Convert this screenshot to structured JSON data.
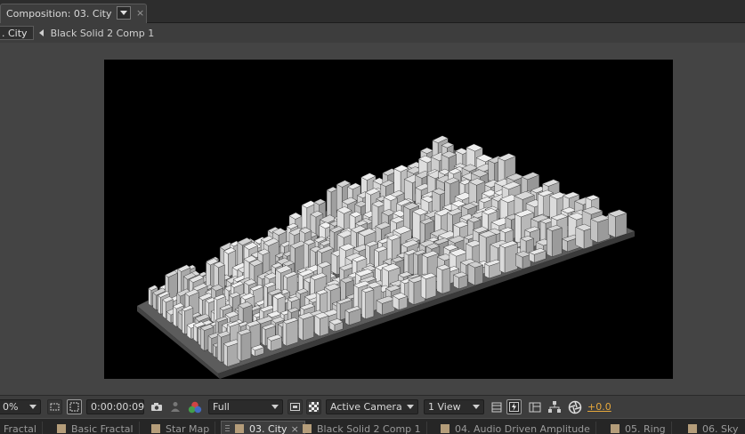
{
  "panel": {
    "tab_title": "Composition: 03. City",
    "menu_icon": "dropdown-triangle",
    "close_glyph": "×"
  },
  "breadcrumb": {
    "active": ". City",
    "next": "Black Solid 2 Comp 1"
  },
  "toolbar": {
    "magnification": "0%",
    "timecode": "0:00:00:09",
    "resolution": "Full",
    "camera": "Active Camera",
    "view_layout": "1 View",
    "exposure": "+0.0",
    "exposure_color": "#e6a83c"
  },
  "comp_tabs": [
    {
      "label": "Fractal"
    },
    {
      "label": "Basic Fractal"
    },
    {
      "label": "Star Map"
    },
    {
      "label": "03. City",
      "active": true,
      "close": "×"
    },
    {
      "label": "Black Solid 2 Comp 1"
    },
    {
      "label": "04. Audio Driven Amplitude"
    },
    {
      "label": "05. Ring"
    },
    {
      "label": "06. Sky"
    }
  ],
  "colors": {
    "panel_bg": "#3d3d3d",
    "viewer_bg": "#444444",
    "comp_bg": "#000000",
    "swatch": "#b59d7a"
  }
}
